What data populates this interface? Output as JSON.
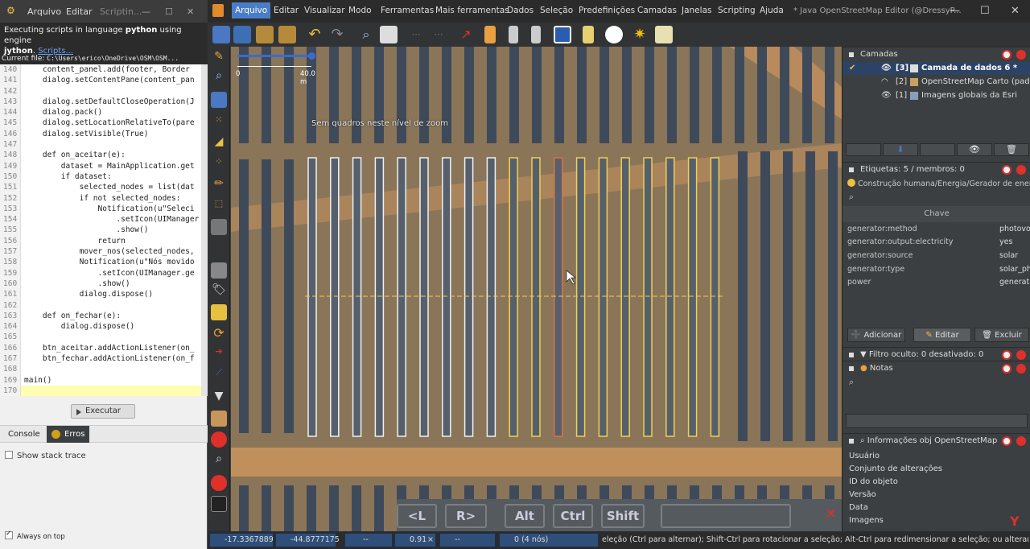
{
  "script_window": {
    "menus": [
      "Arquivo",
      "Editar",
      "Scriptin..."
    ],
    "info_line1": "Executing scripts in language",
    "info_lang": "python",
    "info_mid": " using engine",
    "info_engine": "jython",
    "info_link": "Scripts...",
    "current_file_label": "Current file:",
    "current_file_path": "C:\\Users\\erico\\OneDrive\\OSM\\OSM...",
    "code_lines": [
      {
        "n": "140",
        "t": "    content_panel.add(footer, Border"
      },
      {
        "n": "141",
        "t": "    dialog.setContentPane(content_pan"
      },
      {
        "n": "142",
        "t": ""
      },
      {
        "n": "143",
        "t": "    dialog.setDefaultCloseOperation(J"
      },
      {
        "n": "144",
        "t": "    dialog.pack()"
      },
      {
        "n": "145",
        "t": "    dialog.setLocationRelativeTo(pare"
      },
      {
        "n": "146",
        "t": "    dialog.setVisible(True)"
      },
      {
        "n": "147",
        "t": ""
      },
      {
        "n": "148",
        "t": "    def on_aceitar(e):"
      },
      {
        "n": "149",
        "t": "        dataset = MainApplication.get"
      },
      {
        "n": "150",
        "t": "        if dataset:"
      },
      {
        "n": "151",
        "t": "            selected_nodes = list(dat"
      },
      {
        "n": "152",
        "t": "            if not selected_nodes:"
      },
      {
        "n": "153",
        "t": "                Notification(u\"Seleci"
      },
      {
        "n": "154",
        "t": "                    .setIcon(UIManager"
      },
      {
        "n": "155",
        "t": "                    .show()"
      },
      {
        "n": "156",
        "t": "                return"
      },
      {
        "n": "157",
        "t": "            mover_nos(selected_nodes,"
      },
      {
        "n": "158",
        "t": "            Notification(u\"Nós movido"
      },
      {
        "n": "159",
        "t": "                .setIcon(UIManager.ge"
      },
      {
        "n": "160",
        "t": "                .show()"
      },
      {
        "n": "161",
        "t": "            dialog.dispose()"
      },
      {
        "n": "162",
        "t": ""
      },
      {
        "n": "163",
        "t": "    def on_fechar(e):"
      },
      {
        "n": "164",
        "t": "        dialog.dispose()"
      },
      {
        "n": "165",
        "t": ""
      },
      {
        "n": "166",
        "t": "    btn_aceitar.addActionListener(on_"
      },
      {
        "n": "167",
        "t": "    btn_fechar.addActionListener(on_f"
      },
      {
        "n": "168",
        "t": ""
      },
      {
        "n": "169",
        "t": "main()"
      },
      {
        "n": "170",
        "t": ""
      }
    ],
    "run_button": "Executar",
    "tabs": [
      "Console",
      "Erros"
    ],
    "selected_tab": "Erros",
    "show_stack_trace": "Show stack trace",
    "always_on_top": "Always on top"
  },
  "main_window": {
    "menus": [
      "Arquivo",
      "Editar",
      "Visualizar",
      "Modo",
      "Ferramentas",
      "Mais ferramentas",
      "Dados",
      "Seleção",
      "Predefinições",
      "Camadas",
      "Janelas",
      "Scripting",
      "Ajuda"
    ],
    "selected_menu": "Arquivo",
    "window_title": "* Java OpenStreetMap Editor (@DressyP..."
  },
  "map": {
    "scale_start": "0",
    "scale_end": "40.0 m",
    "no_tiles_message": "Sem quadros neste nível de zoom",
    "keys": [
      "<L",
      "R>",
      "Alt",
      "Ctrl",
      "Shift"
    ]
  },
  "layers_panel": {
    "title": "Camadas",
    "layers": [
      {
        "index": "[3]",
        "name": "Camada de dados 6 *"
      },
      {
        "index": "[2]",
        "name": "OpenStreetMap Carto (padr..."
      },
      {
        "index": "[1]",
        "name": "Imagens globais da Esri"
      }
    ]
  },
  "tags_panel": {
    "title": "Etiquetas: 5 / membros: 0",
    "preset": "Construção humana/Energia/Gerador de ener",
    "column_key": "Chave",
    "tags": [
      {
        "k": "generator:method",
        "v": "photovo"
      },
      {
        "k": "generator:output:electricity",
        "v": "yes"
      },
      {
        "k": "generator:source",
        "v": "solar"
      },
      {
        "k": "generator:type",
        "v": "solar_ph"
      },
      {
        "k": "power",
        "v": "generat"
      }
    ],
    "add_button": "Adicionar",
    "edit_button": "Editar",
    "delete_button": "Excluir"
  },
  "filter_panel": {
    "title": "Filtro oculto: 0 desativado: 0"
  },
  "notes_panel": {
    "title": "Notas"
  },
  "info_panel": {
    "title": "Informações obj OpenStreetMap",
    "fields": [
      "Usuário",
      "Conjunto de alterações",
      "ID do objeto",
      "Versão",
      "Data",
      "Imagens"
    ]
  },
  "status_bar": {
    "lat": "-17.3367889",
    "lon": "-44.8777175",
    "heading": "--",
    "angle": "0.91",
    "angle_unit": "×",
    "distance": "--",
    "selection": "0 (4 nós)",
    "help": "eleção (Ctrl para alternar); Shift-Ctrl para rotacionar a seleção; Alt-Ctrl para redimensionar a seleção; ou alterar seleção"
  }
}
